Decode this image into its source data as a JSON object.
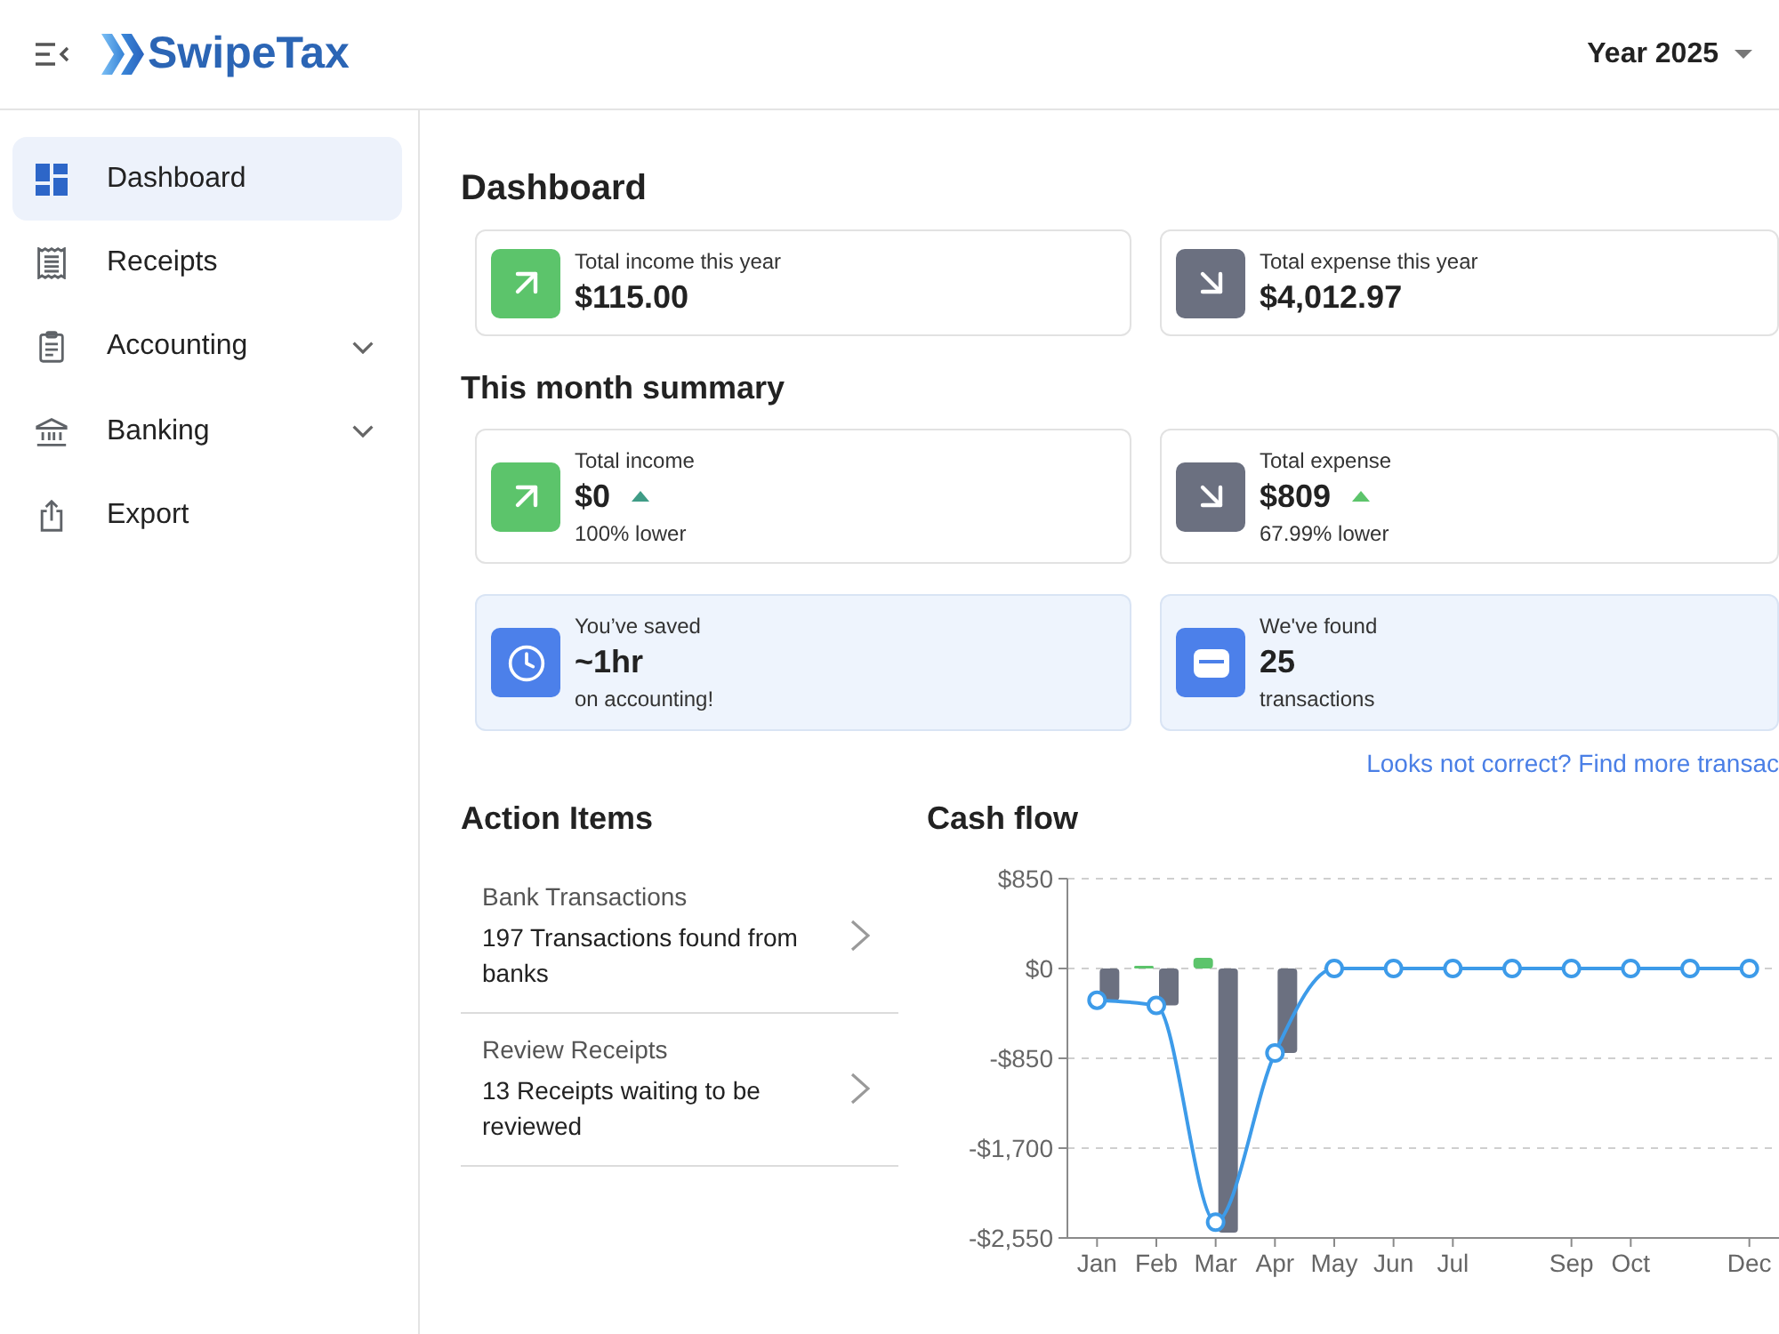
{
  "header": {
    "logo_text": "SwipeTax",
    "year_selector": "Year 2025"
  },
  "sidebar": {
    "items": [
      {
        "label": "Dashboard",
        "selected": true,
        "submenu": false
      },
      {
        "label": "Receipts",
        "selected": false,
        "submenu": false
      },
      {
        "label": "Accounting",
        "selected": false,
        "submenu": true
      },
      {
        "label": "Banking",
        "selected": false,
        "submenu": true
      },
      {
        "label": "Export",
        "selected": false,
        "submenu": false
      }
    ]
  },
  "page_title": "Dashboard",
  "year_summary": [
    {
      "kind": "income",
      "label": "Total income this year",
      "value": "$115.00"
    },
    {
      "kind": "expense",
      "label": "Total expense this year",
      "value": "$4,012.97"
    }
  ],
  "month_summary": {
    "title": "This month summary",
    "cards": [
      {
        "kind": "income",
        "label": "Total income",
        "value": "$0",
        "trend": {
          "up": true,
          "color": "#3f9c86"
        },
        "note": "100% lower"
      },
      {
        "kind": "expense",
        "label": "Total expense",
        "value": "$809",
        "trend": {
          "up": true,
          "color": "#5cc46b"
        },
        "note": "67.99% lower"
      }
    ],
    "highlights": [
      {
        "kind": "time",
        "label": "You’ve saved",
        "value": "~1hr",
        "note": "on accounting!"
      },
      {
        "kind": "transactions",
        "label": "We've found",
        "value": "25",
        "note": "transactions"
      }
    ],
    "link": "Looks not correct? Find more transac"
  },
  "action_items": {
    "title": "Action Items",
    "items": [
      {
        "title": "Bank Transactions",
        "description": "197 Transactions found from banks"
      },
      {
        "title": "Review Receipts",
        "description": "13 Receipts waiting to be reviewed"
      }
    ]
  },
  "cash_flow": {
    "chart_data": {
      "type": "bar",
      "title": "Cash flow",
      "categories": [
        "Jan",
        "Feb",
        "Mar",
        "Apr",
        "May",
        "Jun",
        "Jul",
        null,
        "Sep",
        "Oct",
        null,
        "Dec"
      ],
      "stacked": false,
      "grid": true,
      "series": [
        {
          "color": "#5cc46b",
          "values": [
            0,
            10,
            100,
            0,
            0,
            0,
            0,
            0,
            0,
            0,
            0,
            0
          ]
        },
        {
          "color": "#6b7080",
          "values": [
            -300,
            -350,
            -2500,
            -800,
            0,
            0,
            0,
            0,
            0,
            0,
            0,
            0
          ]
        },
        {
          "type": "line",
          "color": "#3d9be9",
          "marker": "circle",
          "values": [
            -300,
            -350,
            -2400,
            -800,
            0,
            0,
            0,
            0,
            0,
            0,
            0,
            0
          ]
        }
      ],
      "ylim": [
        -2550,
        850
      ],
      "yticks": [
        {
          "value": 850,
          "label": "$850"
        },
        {
          "value": 0,
          "label": "$0"
        },
        {
          "value": -850,
          "label": "-$850"
        },
        {
          "value": -1700,
          "label": "-$1,700"
        },
        {
          "value": -2550,
          "label": "-$2,550"
        }
      ]
    }
  }
}
